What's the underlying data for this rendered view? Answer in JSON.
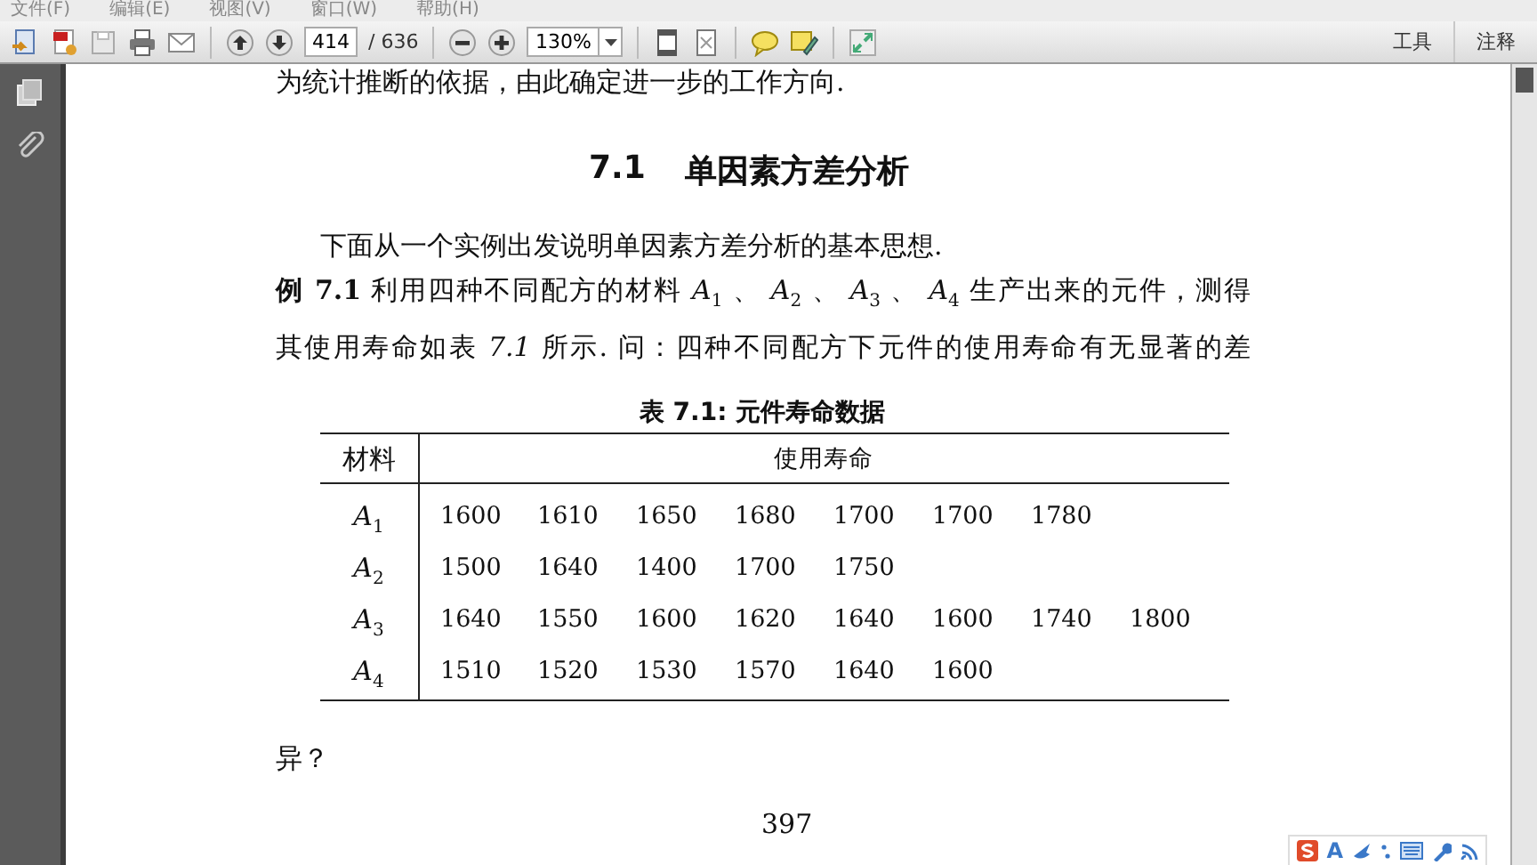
{
  "menu": [
    {
      "label": "文件(F)"
    },
    {
      "label": "编辑(E)"
    },
    {
      "label": "视图(V)"
    },
    {
      "label": "窗口(W)"
    },
    {
      "label": "帮助(H)"
    }
  ],
  "toolbar": {
    "page_number": "414",
    "page_count": "/ 636",
    "zoom": "130%",
    "panel_tabs": [
      "工具",
      "注释"
    ]
  },
  "document": {
    "lead_text": "为统计推断的依据，由此确定进一步的工作方向.",
    "section": {
      "number": "7.1",
      "title": "单因素方差分析"
    },
    "intro": "下面从一个实例出发说明单因素方差分析的基本思想.",
    "example_lines": [
      "**例 7.1** 利用四种不同配方的材料 *A*$_{1}$ 、 *A*$_{2}$ 、 *A*$_{3}$ 、 *A*$_{4}$ 生产出来的元件，测得",
      "其使用寿命如表 *7.1* 所示.  问：四种不同配方下元件的使用寿命有无显著的差"
    ],
    "table": {
      "caption": "表 7.1: 元件寿命数据",
      "columns": [
        "材料",
        "使用寿命"
      ],
      "rows": [
        {
          "label": "*A*$_{1}$",
          "values": [
            "1600",
            "1610",
            "1650",
            "1680",
            "1700",
            "1700",
            "1780"
          ]
        },
        {
          "label": "*A*$_{2}$",
          "values": [
            "1500",
            "1640",
            "1400",
            "1700",
            "1750"
          ]
        },
        {
          "label": "*A*$_{3}$",
          "values": [
            "1640",
            "1550",
            "1600",
            "1620",
            "1640",
            "1600",
            "1740",
            "1800"
          ]
        },
        {
          "label": "*A*$_{4}$",
          "values": [
            "1510",
            "1520",
            "1530",
            "1570",
            "1640",
            "1600"
          ]
        }
      ]
    },
    "continuation": "异？",
    "page_number": "397"
  },
  "ime_bar": {
    "mode": "A"
  }
}
